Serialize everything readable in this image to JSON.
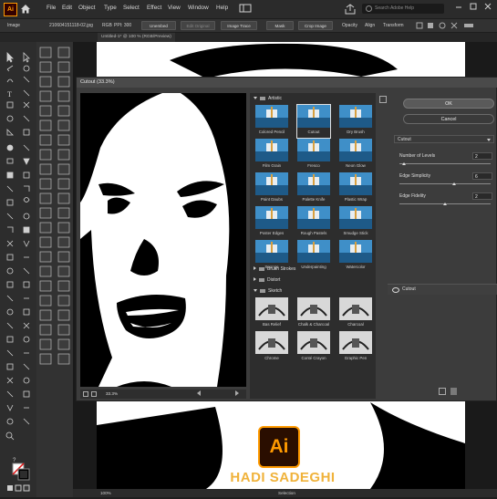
{
  "menubar": {
    "logo": "Ai",
    "items": [
      "File",
      "Edit",
      "Object",
      "Type",
      "Select",
      "Effect",
      "View",
      "Window",
      "Help"
    ],
    "search_placeholder": "Search Adobe Help"
  },
  "control_bar": {
    "object_type": "Image",
    "link_name": "210604151118-02.jpg",
    "color_mode": "RGB",
    "ppi": "PPI: 300",
    "embed_button": "Unembed",
    "edit_original_button": "Edit Original",
    "image_trace_button": "Image Trace",
    "mask_button": "Mask",
    "crop_button": "Crop Image",
    "opacity_label": "Opacity",
    "align_label": "Align",
    "transform_label": "Transform"
  },
  "document_tab": {
    "title": "Untitled-1* @ 100 % (RGB/Preview)"
  },
  "dialog": {
    "title": "Cutout (33.3%)",
    "zoom": "33.3%",
    "gallery": {
      "artistic_folder": "Artistic",
      "artistic_filters": [
        "Colored Pencil",
        "Cutout",
        "Dry Brush",
        "Film Grain",
        "Fresco",
        "Neon Glow",
        "Paint Daubs",
        "Palette Knife",
        "Plastic Wrap",
        "Poster Edges",
        "Rough Pastels",
        "Smudge Stick",
        "Sponge",
        "Underpainting",
        "Watercolor"
      ],
      "selected_filter": "Cutout",
      "other_folders": [
        "Brush Strokes",
        "Distort",
        "Sketch"
      ],
      "sketch_filters": [
        "Bas Relief",
        "Chalk & Charcoal",
        "Charcoal",
        "Chrome",
        "Conté Crayon",
        "Graphic Pen"
      ]
    },
    "ok_button": "OK",
    "cancel_button": "Cancel",
    "filter_select": "Cutout",
    "params": [
      {
        "label": "Number of Levels",
        "value": "2",
        "fraction": 0.05
      },
      {
        "label": "Edge Simplicity",
        "value": "6",
        "fraction": 0.6
      },
      {
        "label": "Edge Fidelity",
        "value": "2",
        "fraction": 0.5
      }
    ],
    "layer_name": "Cutout"
  },
  "status_bar": {
    "zoom": "100%",
    "mode": "Selection"
  },
  "watermark": {
    "logo_text": "Ai",
    "name": "HADI SADEGHI"
  },
  "colors": {
    "accent": "#ff9a00",
    "brand_text": "#f0b23a",
    "ui_dark": "#2b2b2b",
    "ok_button_bg": "#5a5a5a"
  }
}
